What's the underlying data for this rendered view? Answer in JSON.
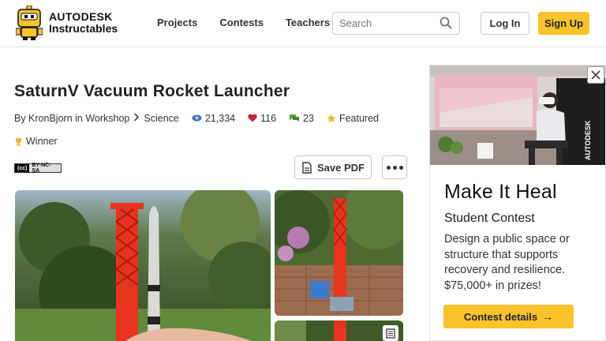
{
  "header": {
    "logo_line1": "AUTODESK",
    "logo_line2": "Instructables",
    "nav": [
      "Projects",
      "Contests",
      "Teachers"
    ],
    "search_placeholder": "Search",
    "login_label": "Log In",
    "signup_label": "Sign Up"
  },
  "article": {
    "title": "SaturnV Vacuum Rocket Launcher",
    "byline": "By KronBjorn in Workshop",
    "category": "Science",
    "views": "21,334",
    "favorites": "116",
    "comments": "23",
    "featured_label": "Featured",
    "winner_label": "Winner",
    "license_badge": "BY-NC-SA",
    "save_pdf_label": "Save PDF"
  },
  "ad": {
    "title": "Make It Heal",
    "subtitle": "Student Contest",
    "body": "Design a public space or structure that supports recovery and resilience. $75,000+ in prizes!",
    "button_label": "Contest details",
    "banner_text": "AUTODESK"
  },
  "colors": {
    "accent": "#fac22b",
    "heart": "#c62828",
    "eye": "#3f6fc1",
    "comment": "#5aa832",
    "star": "#f1b42f"
  }
}
